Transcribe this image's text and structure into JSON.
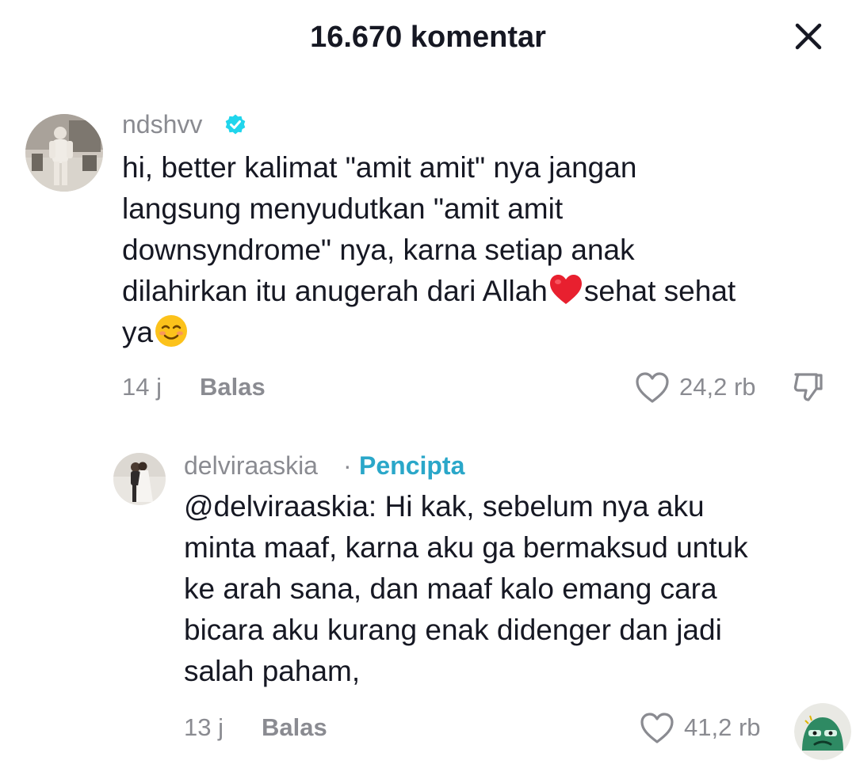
{
  "header": {
    "title": "16.670 komentar",
    "close_icon": "close-icon"
  },
  "comments": [
    {
      "username": "ndshvv",
      "verified": true,
      "lines": [
        "hi, better kalimat \"amit amit\" nya jangan",
        "langsung menyudutkan \"amit amit",
        "downsyndrome\" nya, karna setiap anak"
      ],
      "line4_before": "dilahirkan itu anugerah dari Allah",
      "line4_after": "sehat sehat",
      "line5": "ya",
      "emojis": [
        "red-heart-emoji",
        "smiling-face-emoji"
      ],
      "time": "14 j",
      "reply_label": "Balas",
      "likes": "24,2 rb"
    }
  ],
  "reply": {
    "username": "delviraaskia",
    "separator": "·",
    "badge": "Pencipta",
    "lines": [
      "@delviraaskia: Hi kak, sebelum nya aku",
      "minta maaf, karna aku ga bermaksud untuk",
      "ke arah sana, dan maaf kalo emang cara",
      "bicara aku kurang enak didenger dan jadi",
      "salah paham,"
    ],
    "time": "13 j",
    "reply_label": "Balas",
    "likes": "41,2 rb"
  },
  "colors": {
    "text": "#161823",
    "muted": "#8a8b91",
    "creator": "#2aa7c9",
    "verified": "#20d5ec"
  }
}
